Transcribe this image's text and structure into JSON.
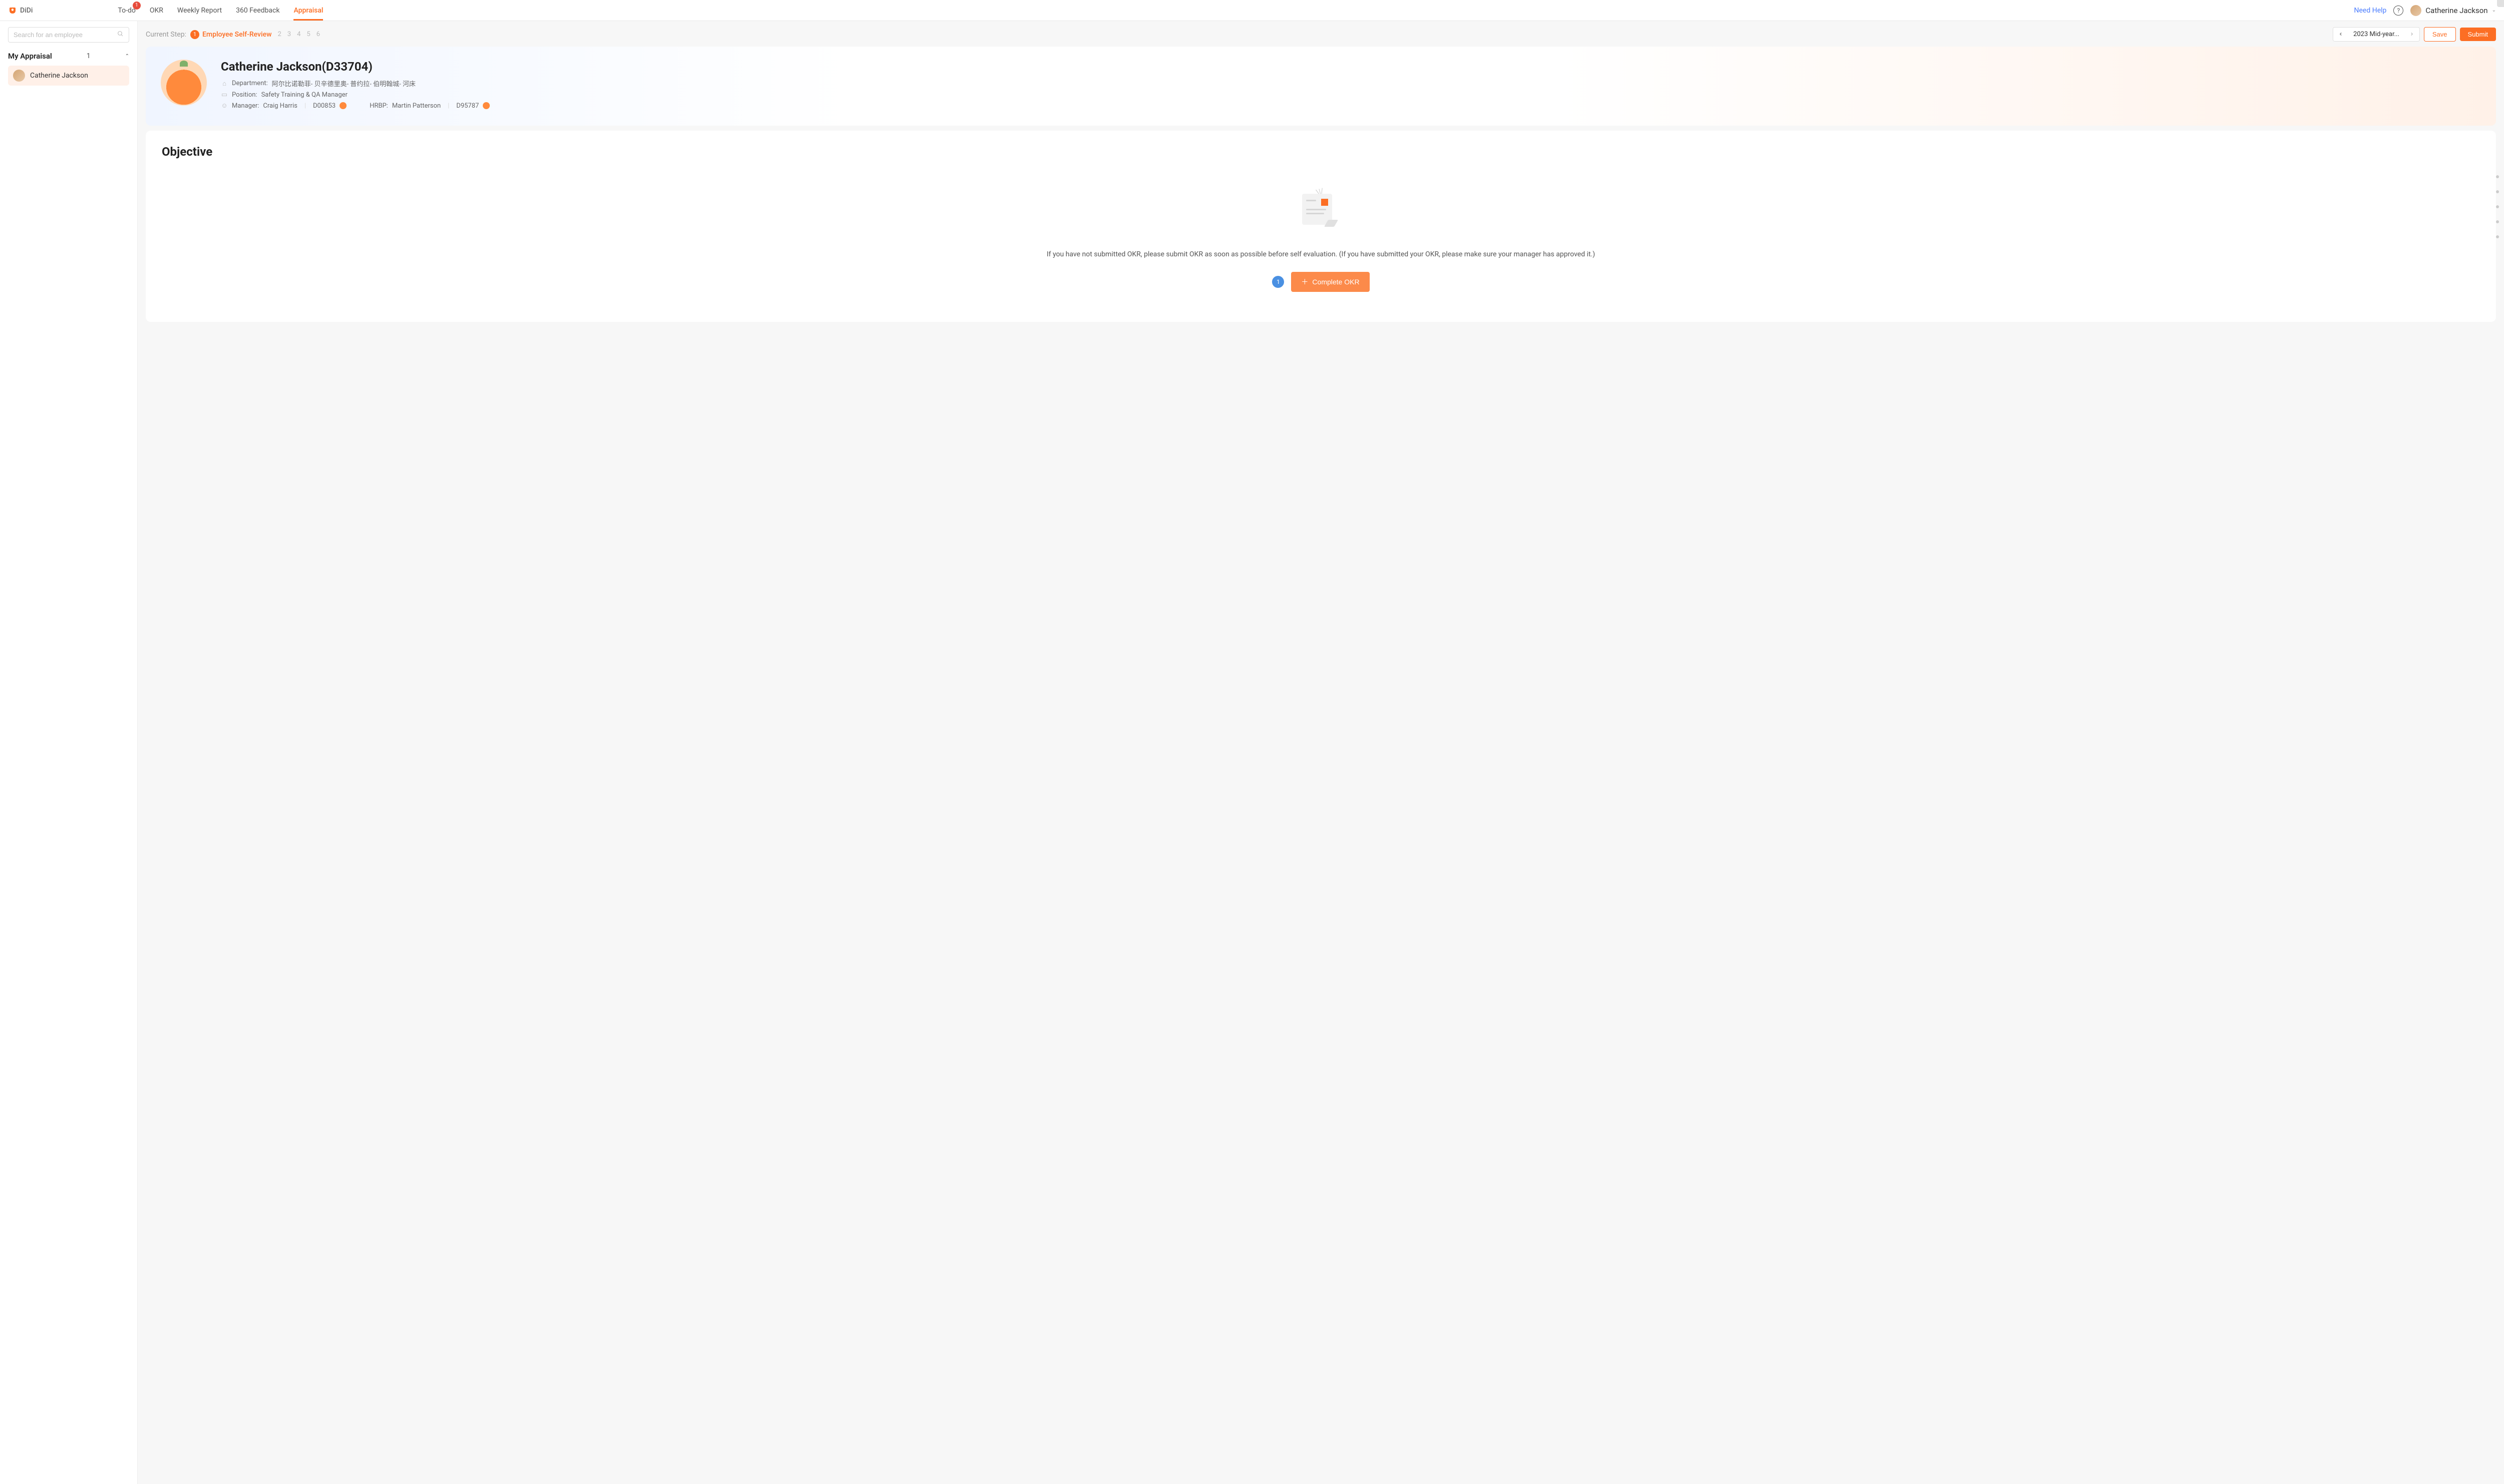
{
  "brand": {
    "name": "DiDi"
  },
  "nav": {
    "todo": {
      "label": "To-do",
      "badge": "1"
    },
    "okr": {
      "label": "OKR"
    },
    "weekly": {
      "label": "Weekly Report"
    },
    "feedback": {
      "label": "360 Feedback"
    },
    "appraisal": {
      "label": "Appraisal"
    }
  },
  "header": {
    "need_help": "Need Help",
    "help_glyph": "?",
    "user_name": "Catherine Jackson"
  },
  "sidebar": {
    "search_placeholder": "Search for an employee",
    "section_title": "My Appraisal",
    "section_count": "1",
    "items": [
      {
        "label": "Catherine Jackson"
      }
    ]
  },
  "topbar": {
    "current_step_label": "Current Step:",
    "active_step_num": "1",
    "active_step_name": "Employee Self-Review",
    "other_steps": [
      "2",
      "3",
      "4",
      "5",
      "6"
    ],
    "period_label": "2023 Mid-year...",
    "save": "Save",
    "submit": "Submit"
  },
  "profile": {
    "name": "Catherine Jackson(D33704)",
    "department_label": "Department:",
    "department_value": "阿尔比诺勒菲- 贝辛德里奥- 普约拉- 伯明翰城- 河床",
    "position_label": "Position:",
    "position_value": "Safety Training & QA Manager",
    "manager_label": "Manager:",
    "manager_name": "Craig Harris",
    "manager_id": "D00853",
    "hrbp_label": "HRBP:",
    "hrbp_name": "Martin Patterson",
    "hrbp_id": "D95787"
  },
  "objective": {
    "title": "Objective",
    "empty_message": "If you have not submitted OKR, please submit OKR as soon as possible before self evaluation. (If you have submitted your OKR, please make sure your manager has approved it.)",
    "badge": "1",
    "complete_label": "Complete OKR"
  }
}
